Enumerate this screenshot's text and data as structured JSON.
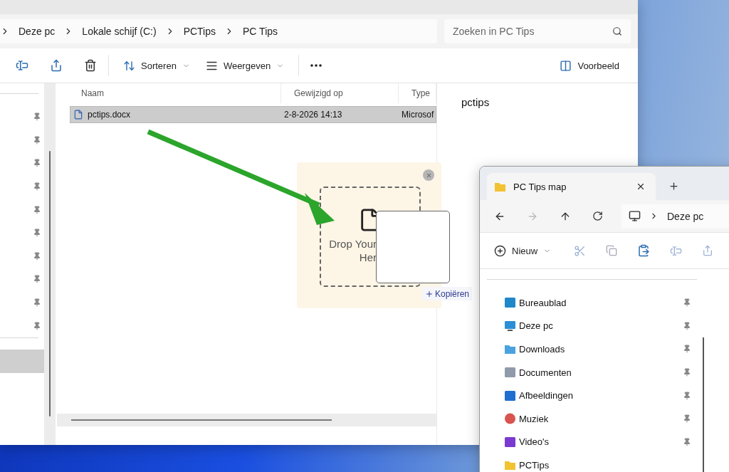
{
  "main_window": {
    "breadcrumbs": [
      {
        "label": "Deze pc"
      },
      {
        "label": "Lokale schijf (C:)"
      },
      {
        "label": "PCTips"
      },
      {
        "label": "PC Tips"
      }
    ],
    "search": {
      "placeholder": "Zoeken in PC Tips"
    },
    "toolbar": {
      "sort": "Sorteren",
      "view": "Weergeven",
      "preview": "Voorbeeld"
    },
    "nav_items": [
      {
        "pinned": true,
        "selected": false
      },
      {
        "pinned": true,
        "selected": false
      },
      {
        "pinned": true,
        "selected": false
      },
      {
        "pinned": true,
        "selected": false
      },
      {
        "pinned": true,
        "selected": false
      },
      {
        "pinned": true,
        "selected": false
      },
      {
        "pinned": true,
        "selected": false
      },
      {
        "pinned": true,
        "selected": false
      },
      {
        "pinned": true,
        "selected": false
      },
      {
        "pinned": true,
        "selected": false
      },
      {
        "pinned": false,
        "selected": true
      }
    ],
    "columns": [
      "Naam",
      "Gewijzigd op",
      "Type"
    ],
    "rows": [
      {
        "cells": [
          "pctips.docx",
          "2-8-2026 14:13",
          "Microsof"
        ],
        "selected": true
      }
    ],
    "preview_title": "pctips"
  },
  "drop_zone": {
    "lines": [
      "Drop Your",
      "Her"
    ],
    "copy_hint": "Kopiëren"
  },
  "second_window": {
    "tab_title": "PC Tips map",
    "address": "Deze pc",
    "new_button": "Nieuw",
    "nav_items": [
      {
        "label": "Bureaublad",
        "kind": "desktop",
        "pinned": true
      },
      {
        "label": "Deze pc",
        "kind": "pc",
        "pinned": true
      },
      {
        "label": "Downloads",
        "kind": "downloads",
        "pinned": true
      },
      {
        "label": "Documenten",
        "kind": "documents",
        "pinned": true
      },
      {
        "label": "Afbeeldingen",
        "kind": "pictures",
        "pinned": true
      },
      {
        "label": "Muziek",
        "kind": "music",
        "pinned": true
      },
      {
        "label": "Video's",
        "kind": "videos",
        "pinned": true
      },
      {
        "label": "PCTips",
        "kind": "folder",
        "pinned": false
      }
    ]
  }
}
